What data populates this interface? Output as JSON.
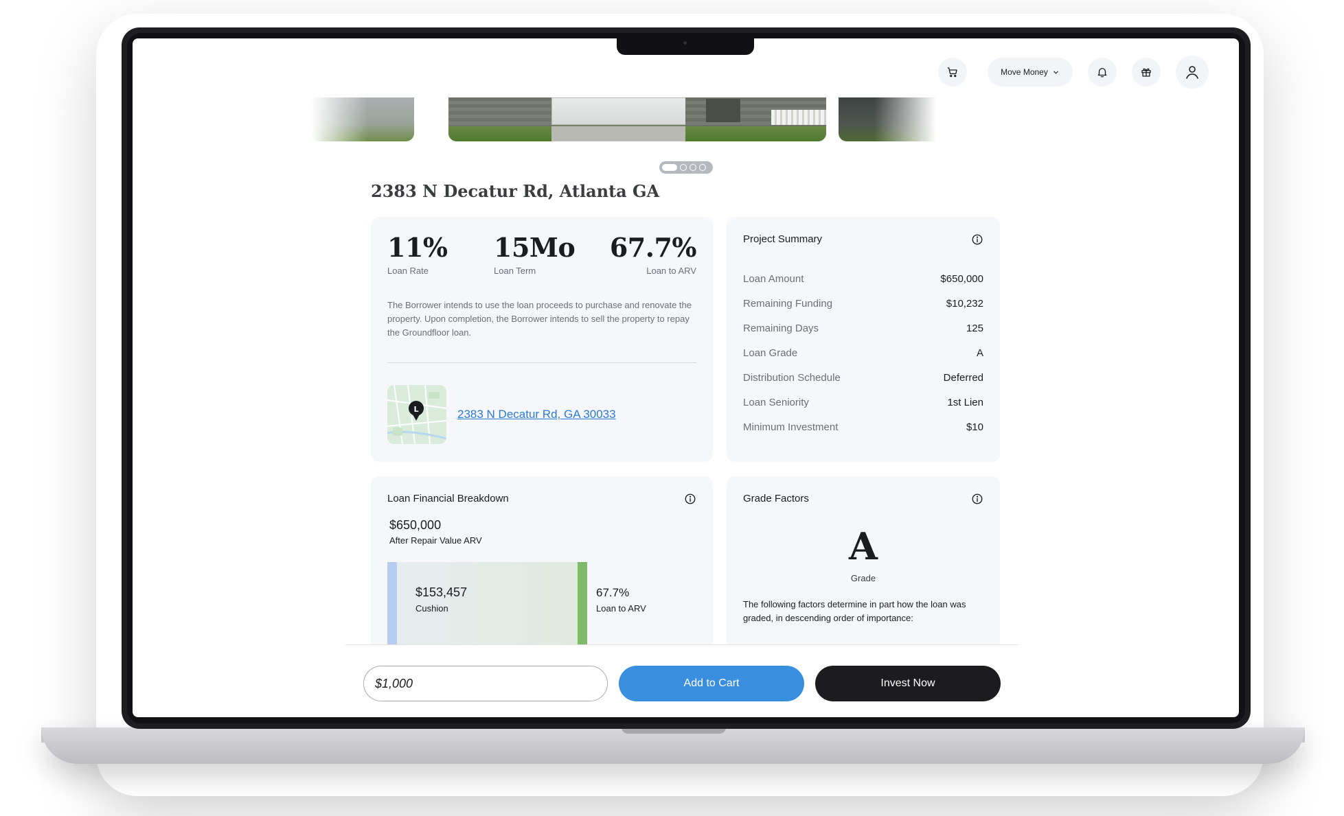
{
  "header": {
    "cart_icon": "cart-icon",
    "move_money_label": "Move Money",
    "bell_icon": "bell-icon",
    "gift_icon": "gift-icon",
    "profile_icon": "user-icon"
  },
  "carousel": {
    "pages": 4,
    "active_index": 0
  },
  "property": {
    "title": "2383 N Decatur Rd, Atlanta GA"
  },
  "stats": [
    {
      "value": "11%",
      "label": "Loan Rate"
    },
    {
      "value": "15Mo",
      "label": "Loan Term"
    },
    {
      "value": "67.7%",
      "label": "Loan to ARV"
    }
  ],
  "description": "The Borrower intends to use the loan proceeds to purchase and renovate the property. Upon completion, the Borrower intends to sell the property to repay the Groundfloor loan.",
  "location": {
    "address_link": "2383 N Decatur Rd, GA 30033"
  },
  "summary": {
    "title": "Project Summary",
    "rows": [
      {
        "label": "Loan Amount",
        "value": "$650,000"
      },
      {
        "label": "Remaining Funding",
        "value": "$10,232"
      },
      {
        "label": "Remaining Days",
        "value": "125"
      },
      {
        "label": "Loan Grade",
        "value": "A"
      },
      {
        "label": "Distribution Schedule",
        "value": "Deferred"
      },
      {
        "label": "Loan Seniority",
        "value": "1st Lien"
      },
      {
        "label": "Minimum Investment",
        "value": "$10"
      }
    ]
  },
  "breakdown": {
    "title": "Loan Financial Breakdown",
    "arv_amount": "$650,000",
    "arv_label": "After Repair Value ARV",
    "cushion_amount": "$153,457",
    "cushion_label": "Cushion",
    "ltv_value": "67.7%",
    "ltv_label": "Loan to ARV"
  },
  "grade": {
    "title": "Grade Factors",
    "letter": "A",
    "letter_label": "Grade",
    "description": "The following factors determine in part how the loan was graded, in descending order of importance:"
  },
  "actions": {
    "amount_value": "$1,000",
    "add_to_cart_label": "Add to Cart",
    "invest_now_label": "Invest Now"
  },
  "colors": {
    "primary_blue": "#3a8ee0",
    "dark_button": "#1c1c1f",
    "link": "#2d7ad6",
    "card_bg": "#f5f7fa",
    "cushion_green": "#7fba69",
    "blue_bar": "#b7cdef"
  }
}
